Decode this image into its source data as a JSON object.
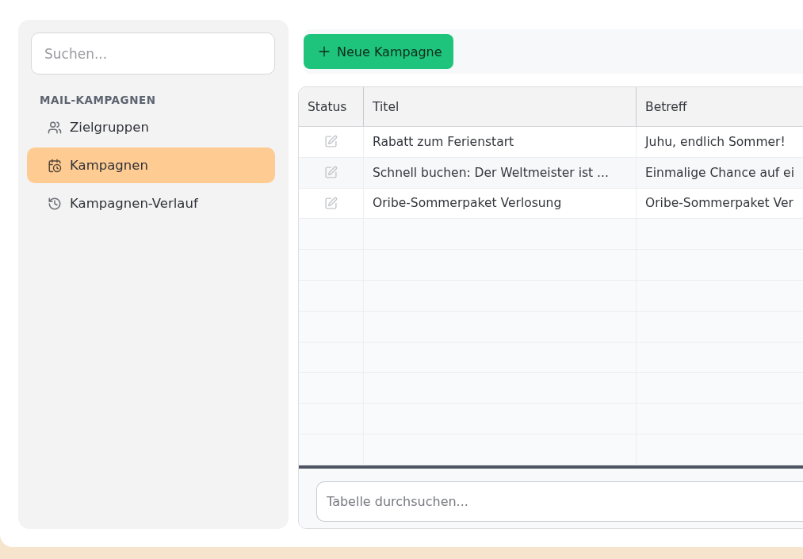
{
  "sidebar": {
    "search": {
      "placeholder": "Suchen..."
    },
    "section_title": "MAIL-KAMPAGNEN",
    "items": [
      {
        "label": "Zielgruppen",
        "selected": false
      },
      {
        "label": "Kampagnen",
        "selected": true
      },
      {
        "label": "Kampagnen-Verlauf",
        "selected": false
      }
    ]
  },
  "toolbar": {
    "new_button": "Neue Kampagne"
  },
  "table": {
    "columns": [
      "Status",
      "Titel",
      "Betreff"
    ],
    "rows": [
      {
        "title": "Rabatt zum Ferienstart",
        "subject": "Juhu, endlich Sommer!"
      },
      {
        "title": "Schnell buchen: Der Weltmeister ist ...",
        "subject": "Einmalige Chance auf ei"
      },
      {
        "title": "Oribe-Sommerpaket Verlosung",
        "subject": "Oribe-Sommerpaket Ver"
      }
    ],
    "search": {
      "placeholder": "Tabelle durchsuchen..."
    }
  }
}
